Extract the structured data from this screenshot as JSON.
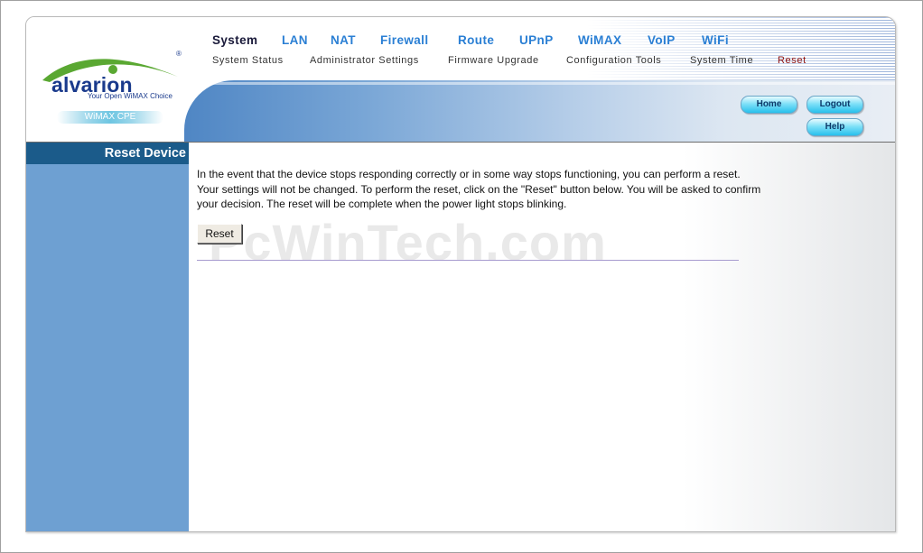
{
  "logo": {
    "brand": "alvarion",
    "registered": "®",
    "tagline": "Your Open WiMAX Choice",
    "product": "WiMAX CPE"
  },
  "main_nav": [
    "System",
    "LAN",
    "NAT",
    "Firewall",
    "Route",
    "UPnP",
    "WiMAX",
    "VoIP",
    "WiFi"
  ],
  "sub_nav": [
    "System Status",
    "Administrator Settings",
    "Firmware Upgrade",
    "Configuration Tools",
    "System Time",
    "Reset"
  ],
  "buttons": {
    "home": "Home",
    "logout": "Logout",
    "help": "Help"
  },
  "sidebar": {
    "title": "Reset Device"
  },
  "content": {
    "description": "In the event that the device stops responding correctly or in some way stops functioning, you can perform a reset. Your settings will not be changed. To perform the reset, click on the \"Reset\" button below. You will be asked to confirm your decision. The reset will be complete when the power light stops blinking.",
    "reset_button": "Reset"
  },
  "watermark": "PcWinTech.com",
  "colors": {
    "nav_link": "#2a7fd4",
    "nav_active": "#1a1a3a",
    "subnav_active": "#8b1010",
    "sidebar_bg": "#6ea0d2",
    "sidebar_title_bg": "#1b5b8a"
  }
}
